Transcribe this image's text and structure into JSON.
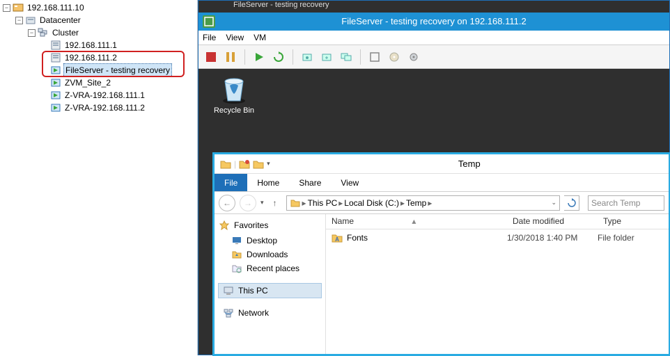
{
  "tree": {
    "root": "192.168.111.10",
    "datacenter": "Datacenter",
    "cluster": "Cluster",
    "host1": "192.168.111.1",
    "host2": "192.168.111.2",
    "vm_file": "FileServer - testing recovery",
    "vm_site": "ZVM_Site_2",
    "vm_zvra1": "Z-VRA-192.168.111.1",
    "vm_zvra2": "Z-VRA-192.168.111.2"
  },
  "console": {
    "partial_title": "FileServer - testing recovery",
    "title": "FileServer - testing recovery on 192.168.111.2",
    "menu": {
      "file": "File",
      "view": "View",
      "vm": "VM"
    },
    "recycle": "Recycle Bin"
  },
  "explorer": {
    "title": "Temp",
    "ribbon": {
      "file": "File",
      "home": "Home",
      "share": "Share",
      "view": "View"
    },
    "crumbs": {
      "thispc": "This PC",
      "disk": "Local Disk (C:)",
      "temp": "Temp"
    },
    "search_placeholder": "Search Temp",
    "side": {
      "favorites": "Favorites",
      "desktop": "Desktop",
      "downloads": "Downloads",
      "recent": "Recent places",
      "thispc": "This PC",
      "network": "Network"
    },
    "cols": {
      "name": "Name",
      "date": "Date modified",
      "type": "Type"
    },
    "row": {
      "name": "Fonts",
      "date": "1/30/2018 1:40 PM",
      "type": "File folder"
    }
  }
}
